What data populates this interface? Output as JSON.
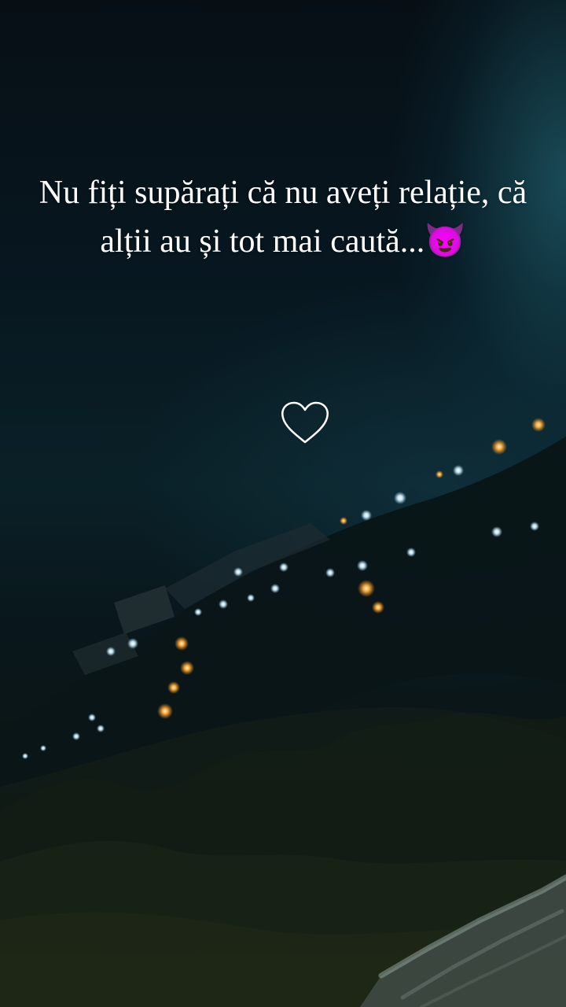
{
  "story": {
    "caption": "Nu fiți supărați că nu aveți relație, că alții au și tot mai caută...😈"
  },
  "icons": {
    "like": "heart-outline-icon",
    "emoji": "smiling-devil-emoji"
  },
  "colors": {
    "text": "#ffffff",
    "background_dark": "#06121a",
    "background_teal": "#2a7887",
    "city_light_warm": "#ffb24a",
    "city_light_cool": "#e8f6ff"
  }
}
